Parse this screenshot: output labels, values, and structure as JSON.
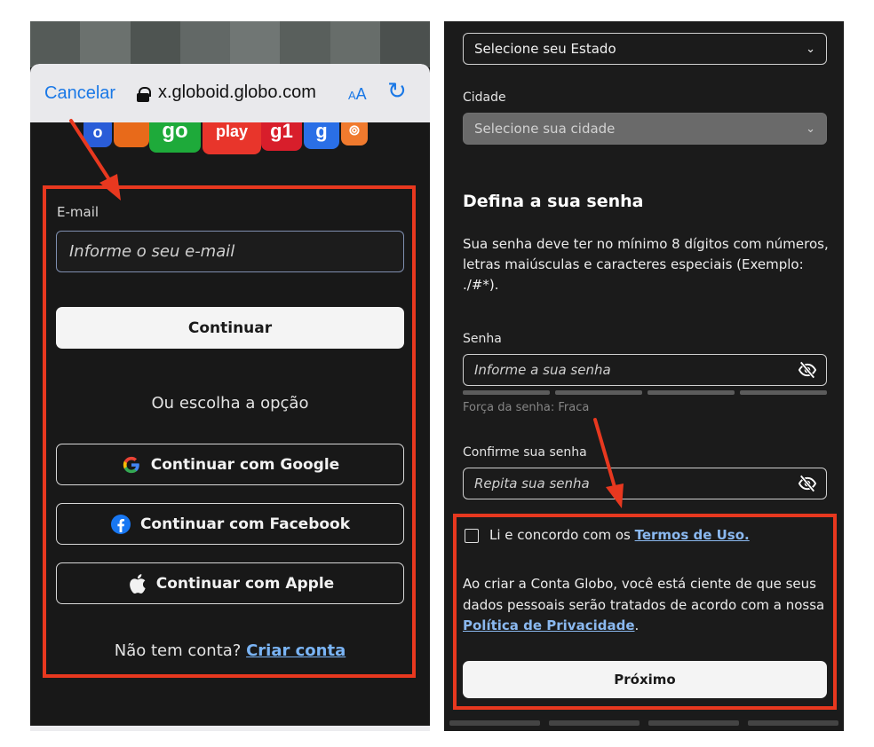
{
  "left": {
    "browser": {
      "cancel_label": "Cancelar",
      "url": "x.globoid.globo.com",
      "text_size_label": "AA",
      "reload_icon": "reload-icon"
    },
    "logos": [
      "o",
      "",
      "go",
      "play",
      "g1",
      "g",
      "⊚"
    ],
    "form": {
      "email_label": "E-mail",
      "email_placeholder": "Informe o seu e-mail",
      "continue_label": "Continuar",
      "or_text": "Ou escolha a opção",
      "google_label": "Continuar com Google",
      "facebook_label": "Continuar com Facebook",
      "apple_label": "Continuar com Apple",
      "no_account_text": "Não tem conta?",
      "create_account_label": "Criar conta"
    },
    "toolbar": {
      "back_icon": "‹",
      "forward_icon": "›",
      "share_icon": "share-icon"
    }
  },
  "right": {
    "state_select": "Selecione seu Estado",
    "city_label": "Cidade",
    "city_select": "Selecione sua cidade",
    "password_heading": "Defina a sua senha",
    "password_rules": "Sua senha deve ter no mínimo 8 dígitos com números, letras maiúsculas e caracteres especiais (Exemplo: ./#*).",
    "password_label": "Senha",
    "password_placeholder": "Informe a sua senha",
    "strength_text": "Força da senha: Fraca",
    "confirm_label": "Confirme sua senha",
    "confirm_placeholder": "Repita sua senha",
    "terms_text": "Li e concordo com os",
    "terms_link": "Termos de Uso.",
    "privacy_text": "Ao criar a Conta Globo, você está ciente de que seus dados pessoais serão tratados de acordo com a nossa",
    "privacy_link": "Política de Privacidade",
    "privacy_end": ".",
    "next_label": "Próximo"
  },
  "colors": {
    "highlight_frame": "#e8381f",
    "link_blue": "#7ab4f5",
    "ios_blue": "#1a78e6"
  }
}
